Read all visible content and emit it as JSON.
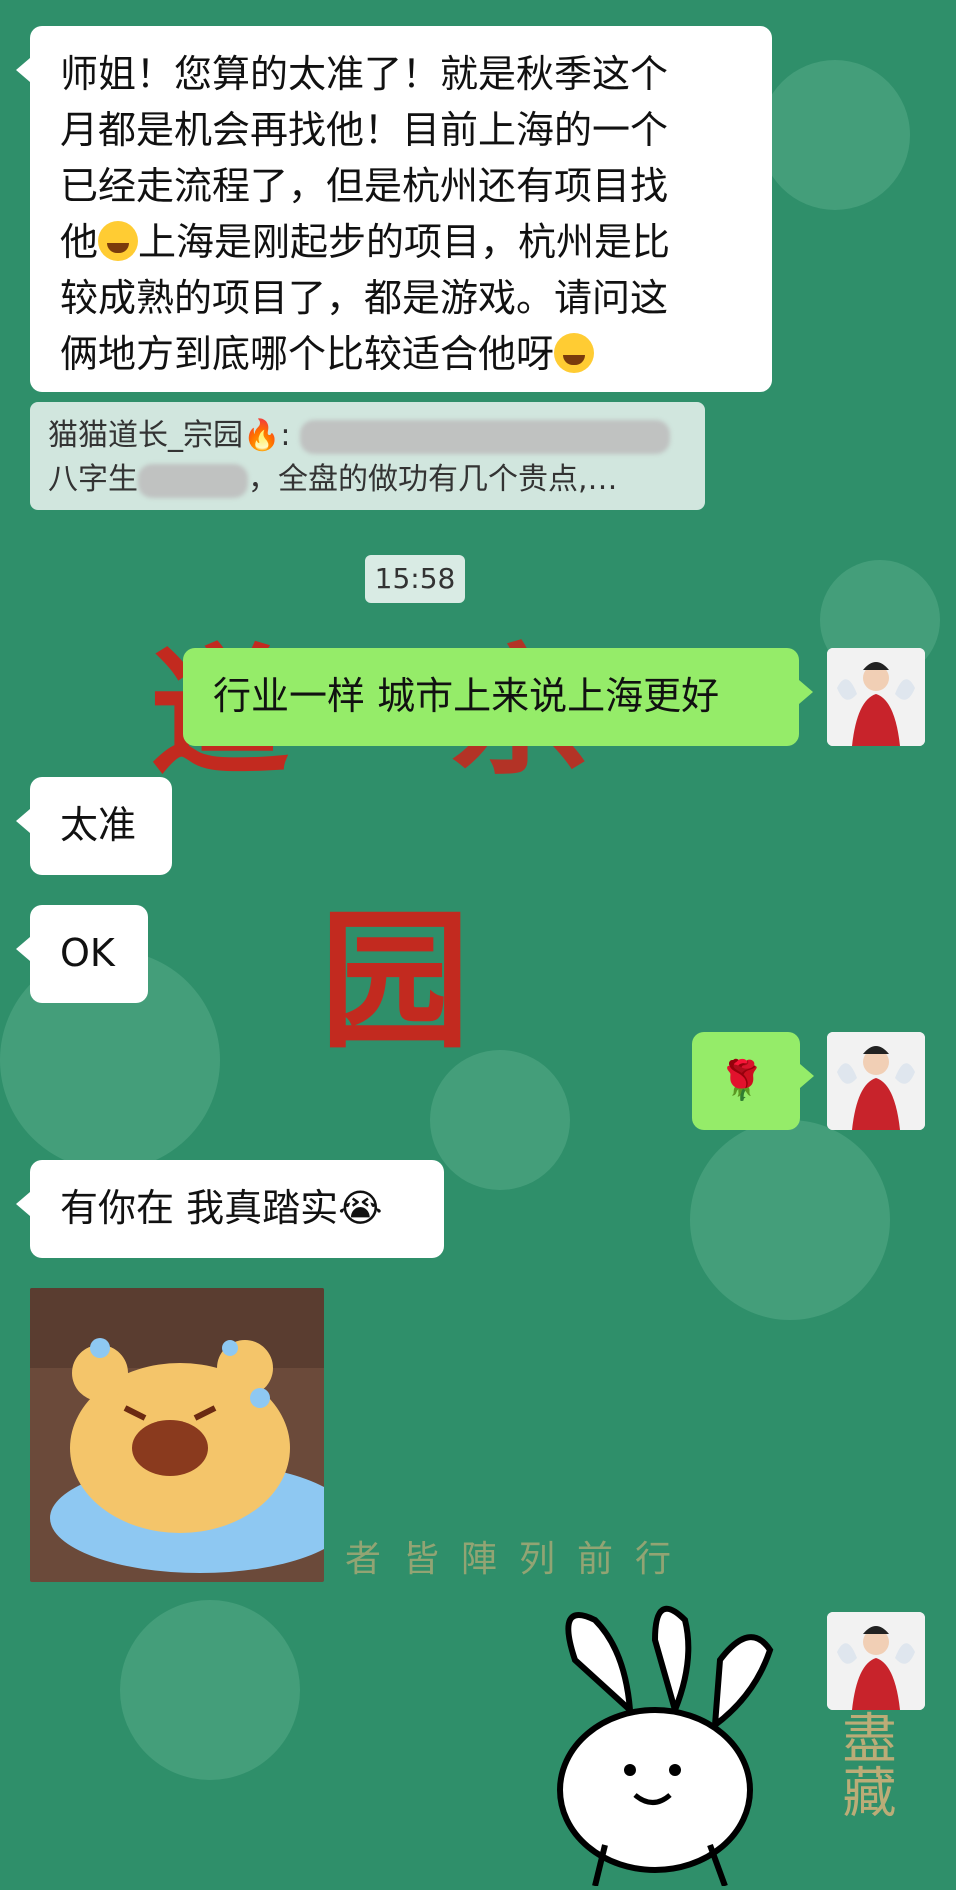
{
  "messages": {
    "m1_line1": "师姐！您算的太准了！就是秋季这个",
    "m1_line2": "月都是机会再找他！目前上海的一个",
    "m1_line3": "已经走流程了，但是杭州还有项目找",
    "m1_line4a": "他",
    "m1_line4b": "上海是刚起步的项目，杭州是比",
    "m1_line5": "较成熟的项目了，都是游戏。请问这",
    "m1_line6": "俩地方到底哪个比较适合他呀",
    "quote_name": "猫猫道长_宗园🔥:",
    "quote_line2a": "八字生",
    "quote_line2b": "，全盘的做功有几个贵点,…",
    "time": "15:58",
    "reply1": "行业一样 城市上来说上海更好",
    "in2": "太准",
    "in3": "OK",
    "rose": "🌹",
    "in4": "有你在 我真踏实😭"
  },
  "background": {
    "big_chars": [
      "道",
      "宗",
      "园"
    ],
    "caption": "者皆陣列前行",
    "vertical": "盡藏"
  },
  "colors": {
    "bg": "#2f8f6a",
    "incoming": "#ffffff",
    "outgoing": "#95ec69"
  },
  "icons": {
    "laugh_emoji": "tears-of-joy-icon",
    "bear_sticker": "crying-bear-sticker",
    "bunny_sticker": "bunny-sticker"
  }
}
